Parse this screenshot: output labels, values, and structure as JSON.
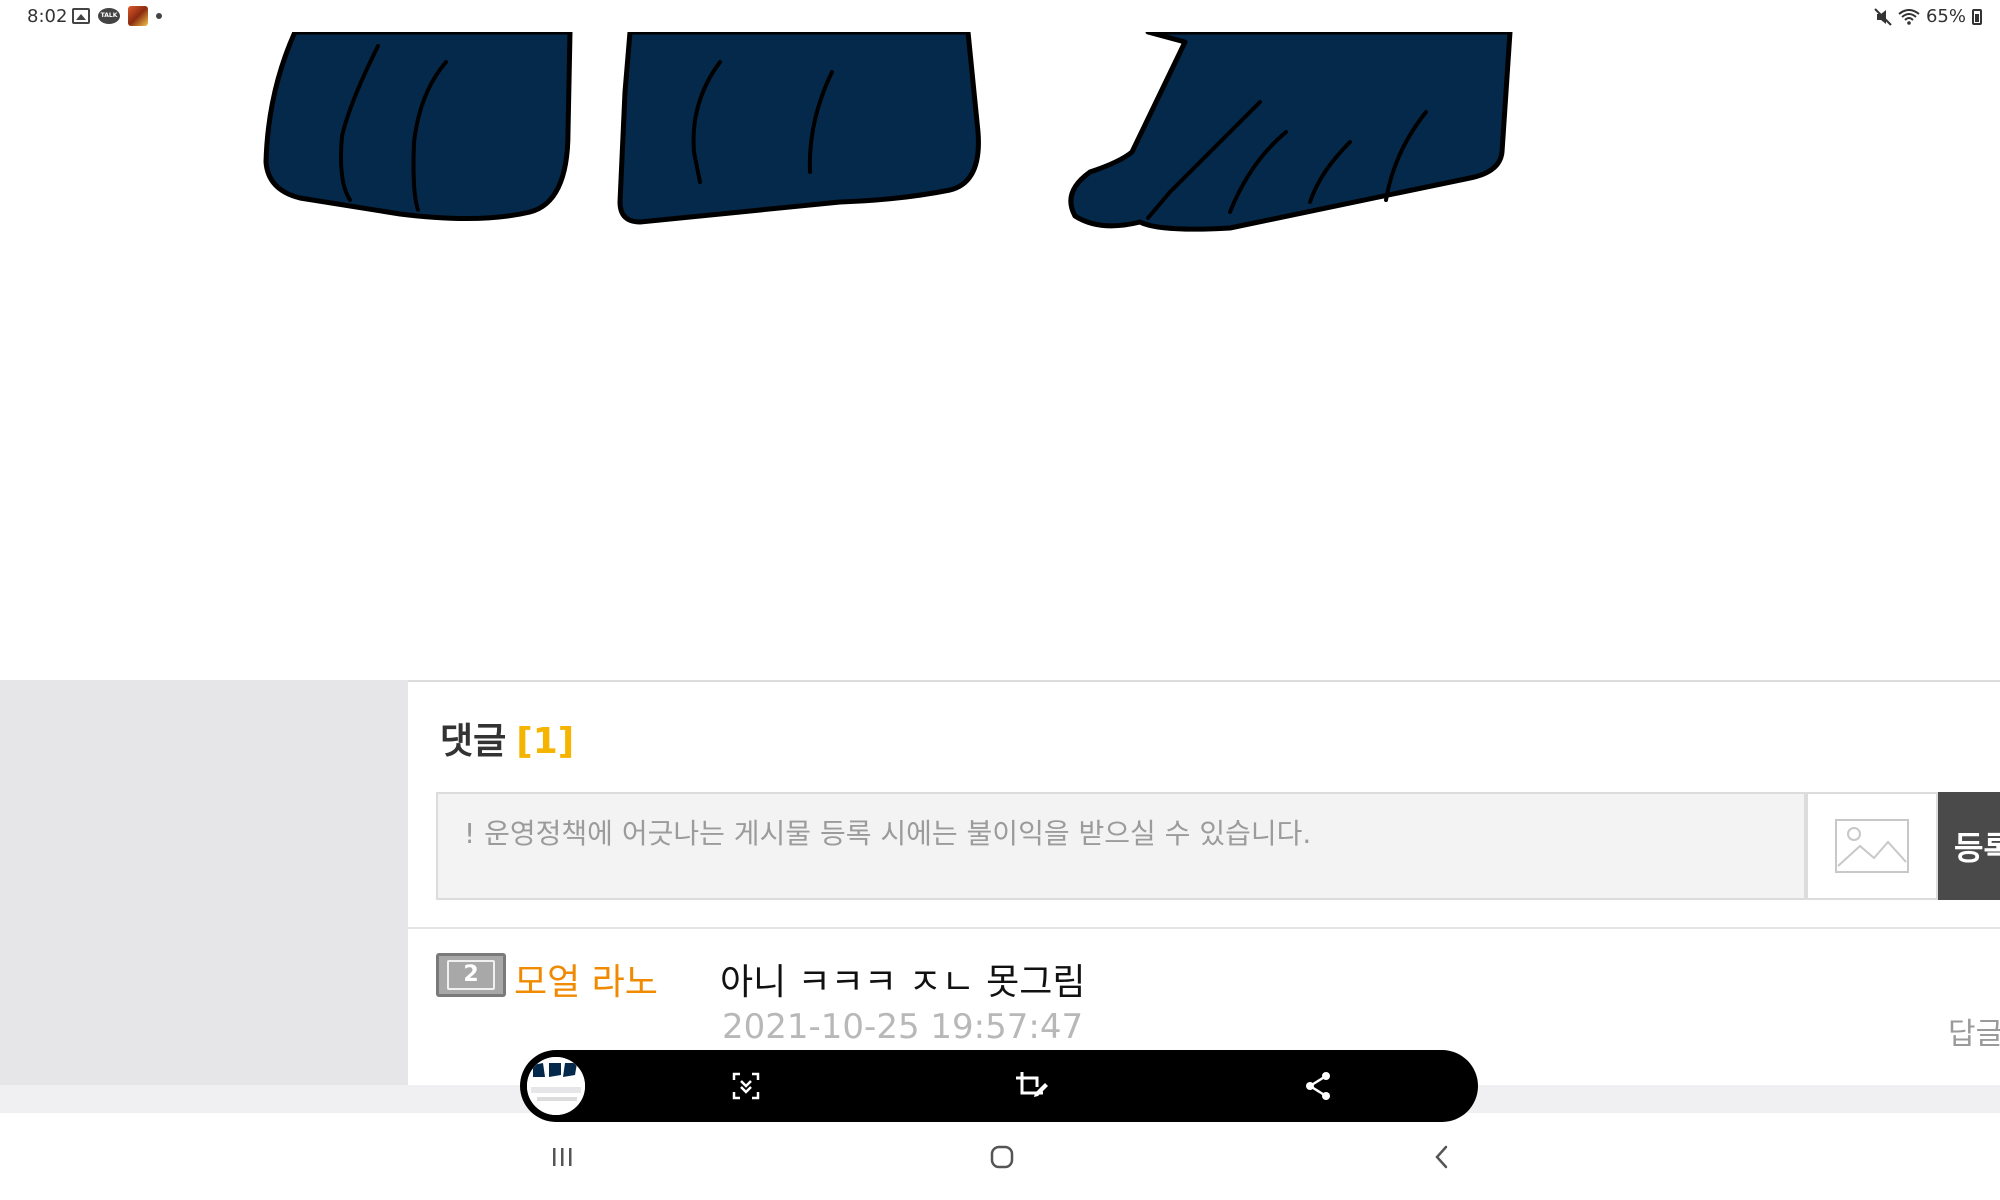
{
  "status_bar": {
    "time": "8:02",
    "battery": "65%",
    "left_icons": [
      "gallery-icon",
      "talk-icon",
      "game-icon",
      "dot-icon"
    ],
    "right_icons": [
      "mute-icon",
      "wifi-icon",
      "battery-icon"
    ]
  },
  "comments": {
    "title": "댓글",
    "count": "[1]",
    "input_placeholder": "! 운영정책에 어긋나는 게시물 등록 시에는 불이익을 받으실 수 있습니다.",
    "submit_label": "등록",
    "items": [
      {
        "level": "2",
        "username": "모얼 라노",
        "text": "아니 ㅋㅋㅋ ㅈㄴ 못그림",
        "date": "2021-10-25 19:57:47",
        "reply_label": "답글"
      }
    ]
  },
  "capture_toolbar": {
    "buttons": [
      "scroll-capture-icon",
      "crop-edit-icon",
      "share-icon"
    ]
  },
  "nav_bar": {
    "buttons": [
      "recent-apps-icon",
      "home-icon",
      "back-icon"
    ]
  },
  "colors": {
    "accent_count": "#f4b400",
    "username": "#f08a00",
    "figure_fill": "#05294a",
    "submit_bg": "#4a4a4a"
  }
}
